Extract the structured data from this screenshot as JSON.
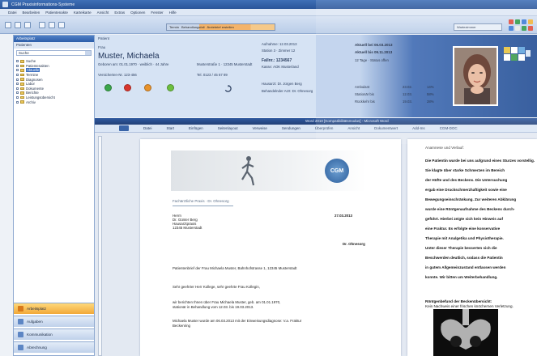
{
  "window": {
    "title": "CGM Praxisinformations-Systeme"
  },
  "menu": [
    "Datei",
    "Bearbeiten",
    "Patientenakte",
    "Karteikarte",
    "Ansicht",
    "Extras",
    "Optionen",
    "Fenster",
    "Hilfe"
  ],
  "toolbar": {
    "strip_items": [
      "Termin",
      "Behandlungsfall",
      "Ärztebrief erstellen"
    ],
    "right_label": "Wartezimmer"
  },
  "sidebar": {
    "header": "Arbeitsplatz",
    "subheader": "Patienten",
    "search_value": "Suche",
    "tree": [
      {
        "label": "Suche",
        "selected": false
      },
      {
        "label": "Patientenakten",
        "selected": false
      },
      {
        "label": "Aktuelle",
        "selected": true
      },
      {
        "label": "Termine",
        "selected": false
      },
      {
        "label": "Diagnosen",
        "selected": false
      },
      {
        "label": "Labor",
        "selected": false
      },
      {
        "label": "Dokumente",
        "selected": false
      },
      {
        "label": "Berichte",
        "selected": false
      },
      {
        "label": "Leistungsübersicht",
        "selected": false
      },
      {
        "label": "Archiv",
        "selected": false
      }
    ],
    "nav_buttons": [
      {
        "label": "Arbeitsplatz",
        "active": true
      },
      {
        "label": "Aufgaben",
        "active": false
      },
      {
        "label": "Kommunikation",
        "active": false
      },
      {
        "label": "Abrechnung",
        "active": false
      }
    ]
  },
  "patient": {
    "section_label": "Patient",
    "title_label": "Frau",
    "name": "Muster, Michaela",
    "dob": "Geboren am: 01.01.1970 · weiblich · 44 Jahre",
    "insurance": "Versicherten-Nr. 123-456",
    "address": "Musterstraße 1 · 12345 Musterstadt",
    "phone": "Tel. 0123 / 45 67 89",
    "status": "Aufnahme: 12.03.2013",
    "case": "Fallnr.: 1234567",
    "case_note": "Kasse: AOK Musterland",
    "doctor": "Hausarzt: Dr. Jürgen Berg",
    "ward": "Station 3 · Zimmer 12",
    "treat_label": "Behandelnder Arzt: Dr. Ohnesorg",
    "visit1": "Aktuell bei 06.03.2013",
    "visit2": "Aktuell bis 09.11.2013",
    "visit3": "12 Tage · Status offen",
    "stat_rows": [
      {
        "label": "Ambulant",
        "v1": "23.02.",
        "v2": "14%"
      },
      {
        "label": "Stationär bis",
        "v1": "12.03.",
        "v2": "58%"
      },
      {
        "label": "Rückkehr bis",
        "v1": "19.03.",
        "v2": "28%"
      }
    ]
  },
  "colors": {
    "accent": "#2d5ea8",
    "header_dark": "#1e4a92",
    "active_nav": "#f2a93a"
  },
  "icons": [
    "status-green-icon",
    "status-red-icon",
    "status-orange-icon",
    "status-lightgreen-icon",
    "refresh-icon"
  ],
  "word": {
    "title": "Word 2010 [Kompatibilitätsmodus] - Microsoft Word",
    "tabs": [
      "Datei",
      "Start",
      "Einfügen",
      "Seitenlayout",
      "Verweise",
      "Sendungen",
      "Überprüfen",
      "Ansicht",
      "Dokumentwert",
      "Add-Ins",
      "CGM-DOC"
    ],
    "letter": {
      "logo": "CGM",
      "sender_line": "Fachärztliche Praxis · Dr. Ohnesorg",
      "date": "27.03.2013",
      "recipient_lines": [
        "Herrn",
        "Dr. Günter Berg",
        "Hausarztpraxis",
        "12345 Musterstadt"
      ],
      "subject": "Dr. Ohnesorg",
      "ref": "Patientenbrief der Frau Michaela Muster, Bahnhofstrasse 1, 12345 Musterstadt",
      "salutation": "Sehr geehrter Herr Kollege, sehr geehrte Frau Kollegin,",
      "body1": "wir berichten Ihnen über Frau Michaela Muster, geb. am 01.01.1970,",
      "body2": "stationär in Behandlung vom 12.03. bis 19.03.2013.",
      "body3": "Michaela Muster wurde am 06.03.2013 mit der Einweisungsdiagnose: V.a. Fraktur",
      "body4": "Beckenring"
    },
    "right_page": {
      "heading": "Anamnese und Verlauf:",
      "lines": [
        "Die Patientin wurde bei uns aufgrund eines Sturzes vorstellig.",
        "Sie klagte über starke Schmerzen im Bereich",
        "der Hüfte und des Beckens. Die Untersuchung",
        "ergab eine Druckschmerzhaftigkeit sowie eine",
        "Bewegungseinschränkung. Zur weiteren Abklärung",
        "wurde eine Röntgenaufnahme des Beckens durch-",
        "geführt. Hierbei zeigte sich kein Hinweis auf",
        "eine Fraktur. Es erfolgte eine konservative",
        "Therapie mit Analgetika und Physiotherapie.",
        "Unter dieser Therapie besserten sich die",
        "Beschwerden deutlich, sodass die Patientin",
        "in gutem Allgemeinzustand entlassen werden",
        "konnte. Wir bitten um Weiterbehandlung."
      ],
      "findings_heading": "Röntgenbefund der Beckenübersicht:",
      "findings_line": "Kein Nachweis einer frischen knöchernen Verletzung."
    }
  }
}
